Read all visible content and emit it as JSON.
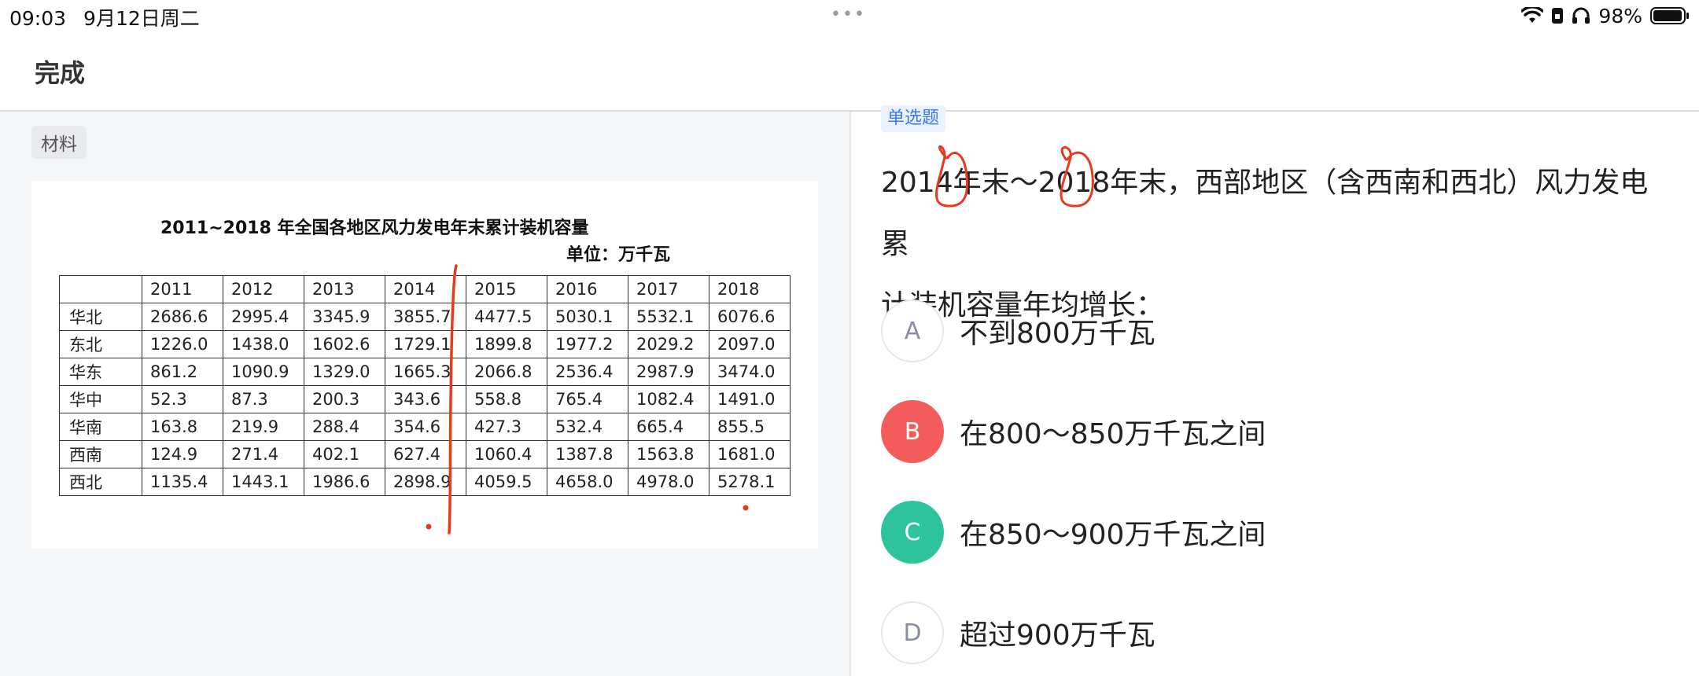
{
  "status_bar": {
    "time": "09:03",
    "date": "9月12日周二",
    "dots": "•••",
    "battery": "98%",
    "icons": [
      "wifi-icon",
      "portrait-lock-icon",
      "headphones-icon",
      "battery-icon"
    ]
  },
  "topbar": {
    "done_label": "完成"
  },
  "material": {
    "tag": "材料",
    "title": "2011~2018 年全国各地区风力发电年末累计装机容量",
    "unit": "单位：万千瓦",
    "table": {
      "header": [
        "",
        "2011",
        "2012",
        "2013",
        "2014",
        "2015",
        "2016",
        "2017",
        "2018"
      ],
      "rows": [
        [
          "华北",
          "2686.6",
          "2995.4",
          "3345.9",
          "3855.7",
          "4477.5",
          "5030.1",
          "5532.1",
          "6076.6"
        ],
        [
          "东北",
          "1226.0",
          "1438.0",
          "1602.6",
          "1729.1",
          "1899.8",
          "1977.2",
          "2029.2",
          "2097.0"
        ],
        [
          "华东",
          "861.2",
          "1090.9",
          "1329.0",
          "1665.3",
          "2066.8",
          "2536.4",
          "2987.9",
          "3474.0"
        ],
        [
          "华中",
          "52.3",
          "87.3",
          "200.3",
          "343.6",
          "558.8",
          "765.4",
          "1082.4",
          "1491.0"
        ],
        [
          "华南",
          "163.8",
          "219.9",
          "288.4",
          "354.6",
          "427.3",
          "532.4",
          "665.4",
          "855.5"
        ],
        [
          "西南",
          "124.9",
          "271.4",
          "402.1",
          "627.4",
          "1060.4",
          "1387.8",
          "1563.8",
          "1681.0"
        ],
        [
          "西北",
          "1135.4",
          "1443.1",
          "1986.6",
          "2898.9",
          "4059.5",
          "4658.0",
          "4978.0",
          "5278.1"
        ]
      ]
    }
  },
  "question": {
    "type": "单选题",
    "text_line1": "2014年末～2018年末，西部地区（含西南和西北）风力发电累",
    "text_line2": "计装机容量年均增长：",
    "options": [
      {
        "letter": "A",
        "text": "不到800万千瓦",
        "state": "plain"
      },
      {
        "letter": "B",
        "text": "在800～850万千瓦之间",
        "state": "wrong",
        "color": "#f45c5c"
      },
      {
        "letter": "C",
        "text": "在850～900万千瓦之间",
        "state": "correct",
        "color": "#2ec49b"
      },
      {
        "letter": "D",
        "text": "超过900万千瓦",
        "state": "plain"
      }
    ]
  },
  "annotation_color": "#e8391e"
}
